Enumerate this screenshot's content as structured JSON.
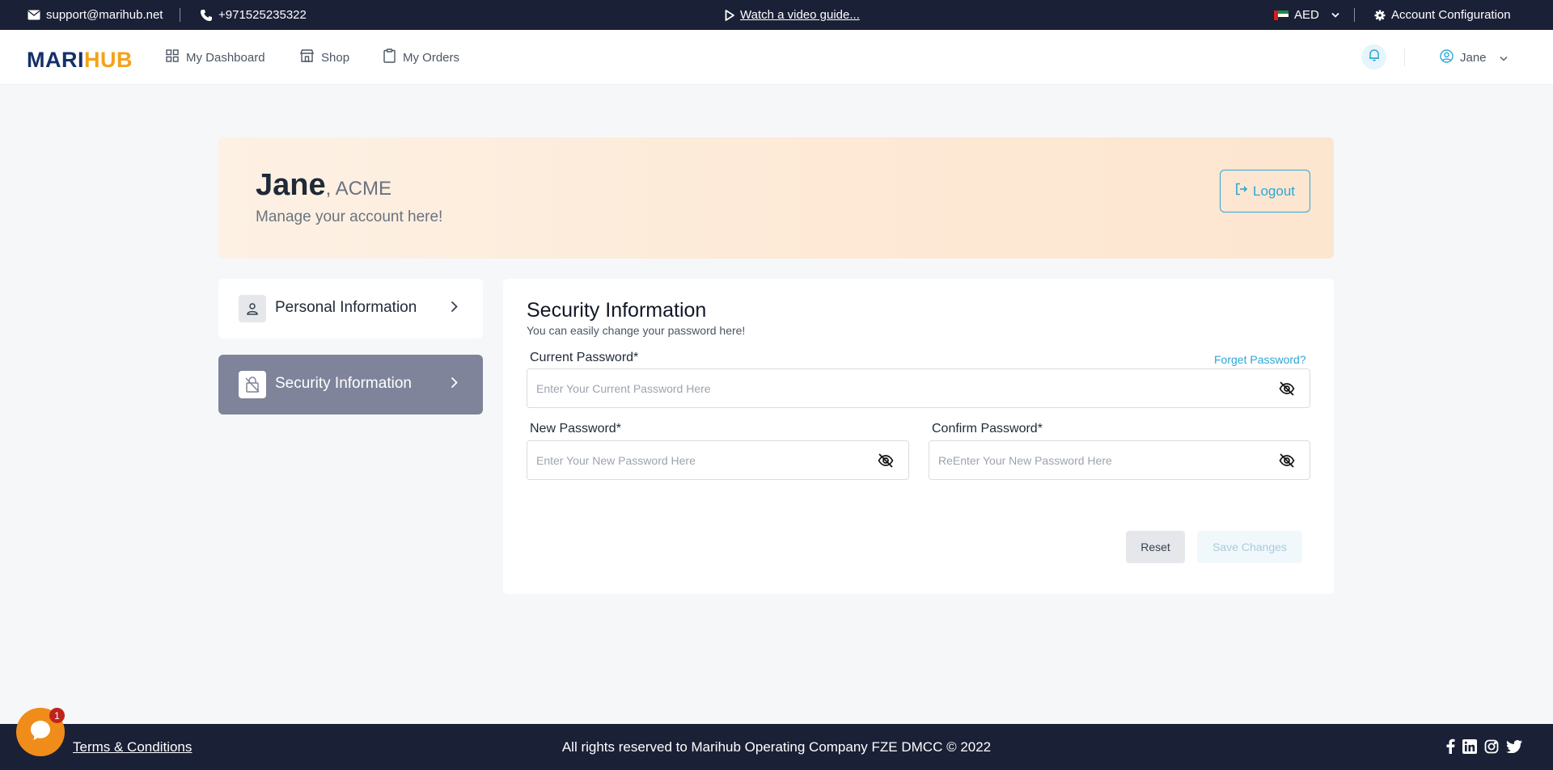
{
  "topbar": {
    "email": "support@marihub.net",
    "phone": "+971525235322",
    "video_link": "Watch a video guide...",
    "currency": "AED",
    "account_config": "Account Configuration"
  },
  "nav": {
    "logo_part1": "MARI",
    "logo_part2": "HUB",
    "items": [
      {
        "label": "My Dashboard"
      },
      {
        "label": "Shop"
      },
      {
        "label": "My Orders"
      }
    ],
    "user": "Jane"
  },
  "banner": {
    "name": "Jane",
    "company": ", ACME",
    "subtitle": "Manage your account here!",
    "logout": "Logout"
  },
  "side_menu": [
    {
      "label": "Personal Information",
      "active": false
    },
    {
      "label": "Security Information",
      "active": true
    }
  ],
  "security": {
    "title": "Security Information",
    "subtitle": "You can easily change your password here!",
    "current_label": "Current Password*",
    "forgot": "Forget Password?",
    "current_placeholder": "Enter Your Current Password Here",
    "new_label": "New Password*",
    "new_placeholder": "Enter Your New Password Here",
    "confirm_label": "Confirm Password*",
    "confirm_placeholder": "ReEnter Your New Password Here",
    "reset": "Reset",
    "save": "Save Changes"
  },
  "footer": {
    "terms": "Terms & Conditions",
    "rights": "All rights reserved to Marihub Operating Company FZE DMCC © 2022"
  },
  "chat": {
    "badge": "1"
  },
  "colors": {
    "dark_bar": "#1a2036",
    "accent": "#2ea6d6",
    "logo_dark": "#14306b",
    "logo_orange": "#f4a21a",
    "active_menu": "#7f849a",
    "chat": "#f08c1a"
  }
}
